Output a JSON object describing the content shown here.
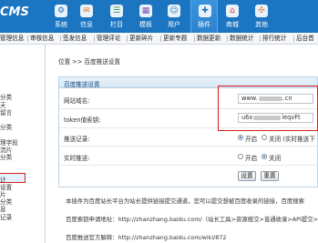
{
  "app": {
    "logo_text": "CMS"
  },
  "top_nav": [
    {
      "label": "系统",
      "icon": "system-icon",
      "glyph": "⚙",
      "color": "#1b75c0"
    },
    {
      "label": "信息",
      "icon": "info-icon",
      "glyph": "✉",
      "color": "#e07a2b"
    },
    {
      "label": "栏目",
      "icon": "column-icon",
      "glyph": "☰",
      "color": "#2b9a48"
    },
    {
      "label": "模板",
      "icon": "template-icon",
      "glyph": "▦",
      "color": "#7a52b3"
    },
    {
      "label": "用户",
      "icon": "user-icon",
      "glyph": "☺",
      "color": "#1b75c0"
    },
    {
      "label": "插件",
      "icon": "plugin-icon",
      "glyph": "✚",
      "color": "#1b75c0"
    },
    {
      "label": "商城",
      "icon": "shop-icon",
      "glyph": "⌂",
      "color": "#d9342b"
    },
    {
      "label": "其他",
      "icon": "other-icon",
      "glyph": "✣",
      "color": "#e07a2b"
    }
  ],
  "sub_menu": [
    "管理信息",
    "审核信息",
    "签发信息",
    "管理评论",
    "更新碎片",
    "更新专题",
    "数据更新",
    "数据统计",
    "排行统计",
    "后台首"
  ],
  "sidebar_items": [
    "",
    "",
    "分类",
    "天",
    "留言",
    "",
    "分类",
    "",
    "理字段",
    "流片",
    "分类",
    "",
    "",
    "计",
    "设置",
    "片",
    "分类",
    "息",
    "记录"
  ],
  "breadcrumb": "位置 >> 百度推送设置",
  "panel_title": "百度推送设置",
  "form": {
    "site_label": "网站域名:",
    "site_value_prefix": "www.",
    "site_value_suffix": ".cn",
    "token_label": "token值索钥:",
    "token_value_prefix": "u6x",
    "token_value_suffix": "leqvFt",
    "push_log_label": "推送记录:",
    "push_log_on": "开启",
    "push_log_off": "关闭 (实时推送下",
    "realtime_label": "实时推送:",
    "realtime_on": "开启",
    "realtime_off": "关闭"
  },
  "buttons": {
    "submit": "设置",
    "reset": "重置"
  },
  "notes": [
    "本插件为百度站长平台为站长提供链接提交通道，您可以提交想被百度收录的链接，百度搜索",
    "百度索钥申请地址：http://zhanzhang.baidu.com/（站长工具>资源搜交>普通收录>API提交>",
    "百度推送官方解释：http://zhanzhang.baidu.com/wiki/872"
  ]
}
